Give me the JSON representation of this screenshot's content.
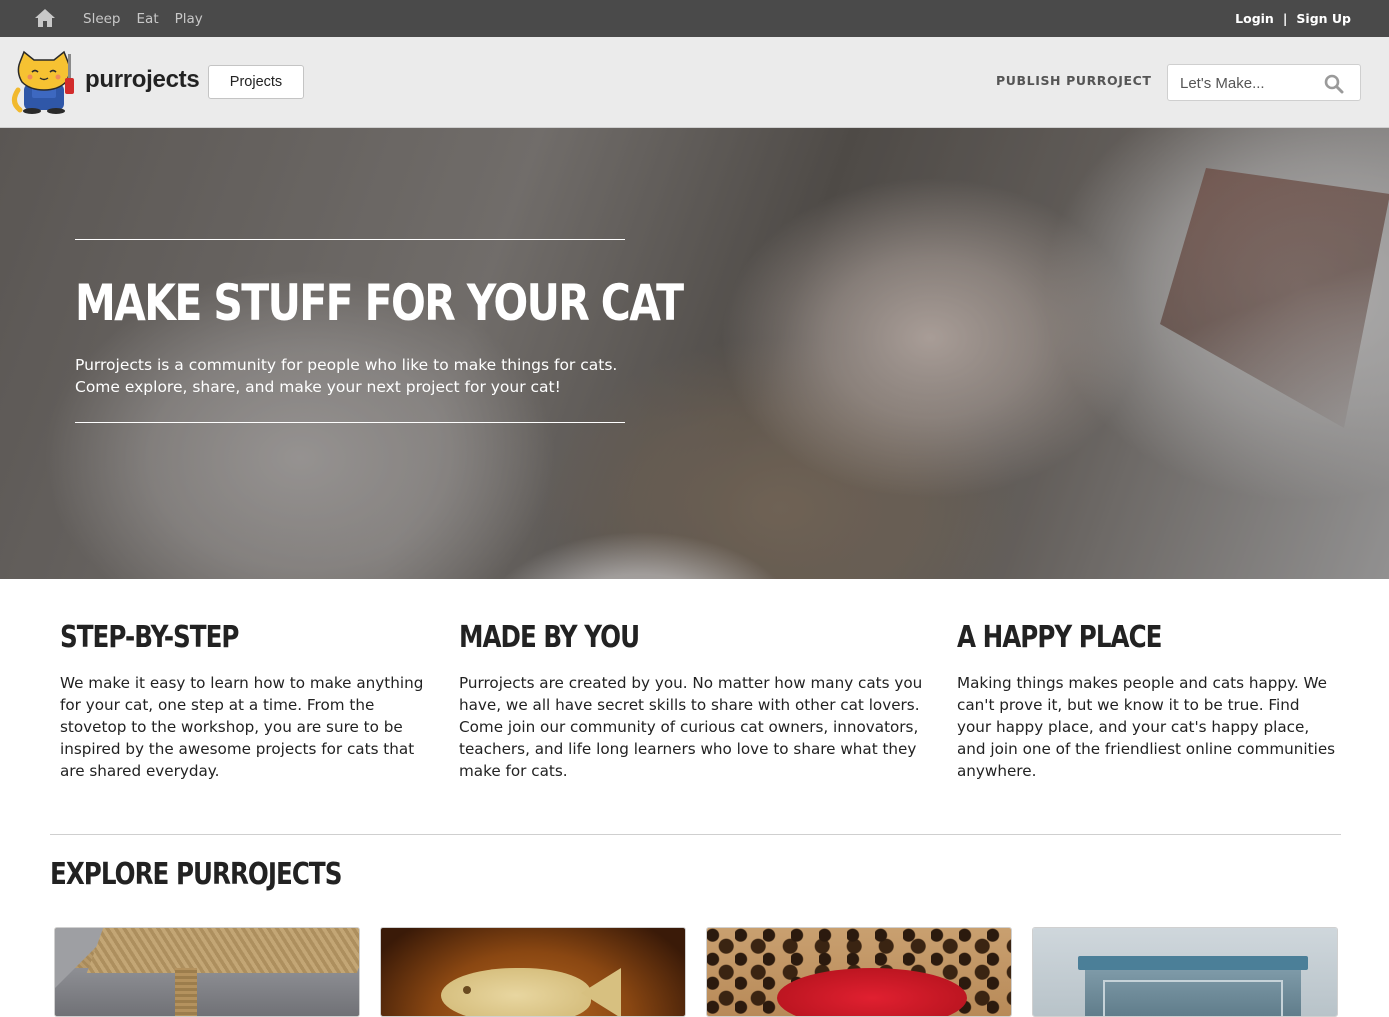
{
  "topbar": {
    "home_icon": "home-icon",
    "nav": [
      "Sleep",
      "Eat",
      "Play"
    ],
    "login": "Login",
    "separator": "|",
    "signup": "Sign Up"
  },
  "header": {
    "logo_text": "purrojects",
    "projects_button": "Projects",
    "publish": "PUBLISH PURROJECT",
    "search_placeholder": "Let's Make...",
    "search_icon": "search-icon"
  },
  "hero": {
    "title": "MAKE STUFF FOR YOUR CAT",
    "description": "Purrojects is a community for people who like to make things for cats. Come explore, share, and make your next project for your cat!"
  },
  "features": [
    {
      "title": "STEP-BY-STEP",
      "text": "We make it easy to learn how to make anything for your cat, one step at a time. From the stovetop to the workshop, you are sure to be inspired by the awesome projects for cats that are shared everyday."
    },
    {
      "title": "MADE BY YOU",
      "text": "Purrojects are created by you. No matter how many cats you have, we all have secret skills to share with other cat lovers. Come join our community of curious cat owners, innovators, teachers, and life long learners who love to share what they make for cats."
    },
    {
      "title": "A HAPPY PLACE",
      "text": "Making things makes people and cats happy. We can't prove it, but we know it to be true. Find your happy place, and your cat's happy place, and join one of the friendliest online communities anywhere."
    }
  ],
  "explore": {
    "title": "EXPLORE PURROJECTS"
  },
  "colors": {
    "topbar_bg": "#4a4a4a",
    "header_bg": "#ebebeb",
    "text": "#222222"
  }
}
